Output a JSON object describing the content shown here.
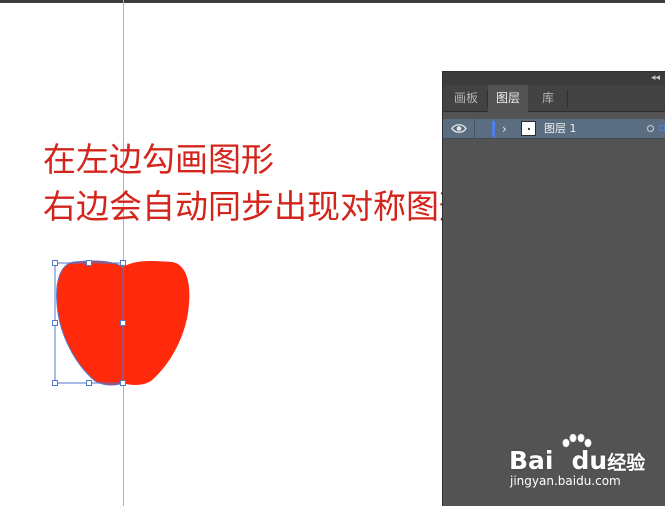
{
  "canvas": {
    "instruction_line1": "在左边勾画图形",
    "instruction_line2": "右边会自动同步出现对称图形",
    "shape_fill": "#ff2a0c",
    "selection_color": "#5577cc",
    "guide_color": "#5fd3e6",
    "text_color": "#d3251c"
  },
  "panel": {
    "collapse_icon": "collapse-icon",
    "tabs": [
      {
        "label": "画板"
      },
      {
        "label": "图层"
      },
      {
        "label": "库"
      }
    ],
    "active_tab": "图层",
    "layers": [
      {
        "name": "图层 1",
        "color": "#4f7fe8"
      }
    ]
  },
  "watermark": {
    "logo": "Bai du 经验",
    "logo_left": "Bai",
    "logo_mid": "du",
    "logo_right": "经验",
    "url": "jingyan.baidu.com"
  }
}
